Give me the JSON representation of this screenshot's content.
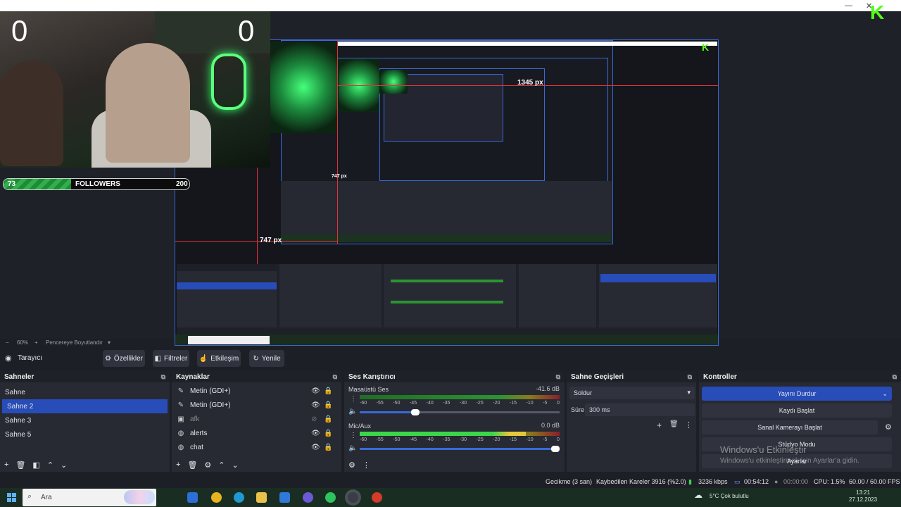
{
  "window": {
    "minimize": "—",
    "close": "✕"
  },
  "overlay": {
    "score_left": "0",
    "score_right": "0",
    "followers": {
      "current": "73",
      "label": "FOLLOWERS",
      "goal": "200",
      "progress": 0.365
    },
    "kick_logo": "K"
  },
  "preview_labels": {
    "width_label": "1345 px",
    "height_label": "747 px",
    "inner_height_label": "747 px"
  },
  "zoom": {
    "minus": "−",
    "value": "60%",
    "plus": "+",
    "fit": "Pencereye Boyutlandır",
    "arrow": "▾"
  },
  "toolbar": {
    "source_label": "Tarayıcı",
    "properties": "Özellikler",
    "filters": "Filtreler",
    "interact": "Etkileşim",
    "refresh": "Yenile"
  },
  "scenes": {
    "title": "Sahneler",
    "items": [
      {
        "label": "Sahne"
      },
      {
        "label": "Sahne 2"
      },
      {
        "label": "Sahne 3"
      },
      {
        "label": "Sahne 5"
      }
    ]
  },
  "sources": {
    "title": "Kaynaklar",
    "items": [
      {
        "label": "Metin (GDI+)",
        "icon": "text-icon"
      },
      {
        "label": "Metin (GDI+)",
        "icon": "text-icon"
      },
      {
        "label": "afk",
        "icon": "image-icon"
      },
      {
        "label": "alerts",
        "icon": "browser-icon"
      },
      {
        "label": "chat",
        "icon": "browser-icon"
      }
    ]
  },
  "mixer": {
    "title": "Ses Karıştırıcı",
    "channels": [
      {
        "name": "Masaüstü Ses",
        "db": "-41.6 dB",
        "level": 0.0,
        "volume": 0.27
      },
      {
        "name": "Mic/Aux",
        "db": "0.0 dB",
        "level": 0.83,
        "volume": 1.0
      }
    ],
    "ticks": [
      "-60",
      "-55",
      "-50",
      "-45",
      "-40",
      "-35",
      "-30",
      "-25",
      "-20",
      "-15",
      "-10",
      "-5",
      "0"
    ]
  },
  "transitions": {
    "title": "Sahne Geçişleri",
    "selected": "Soldur",
    "duration_label": "Süre",
    "duration": "300 ms"
  },
  "controls": {
    "title": "Kontroller",
    "stop_stream": "Yayını Durdur",
    "start_recording": "Kaydı Başlat",
    "start_virtualcam": "Sanal Kamerayı Başlat",
    "studio_mode": "Stüdyo Modu",
    "settings": "Ayarlar",
    "watermark_title": "Windows'u Etkinleştir",
    "watermark_body": "Windows'u etkinleştirmek için Ayarlar'a gidin."
  },
  "status": {
    "delay": "Gecikme (3 san)",
    "dropped": "Kaybedilen Kareler 3916 (%2.0)",
    "bitrate": "3236 kbps",
    "live_time": "00:54:12",
    "rec_time": "00:00:00",
    "cpu": "CPU: 1.5%",
    "fps": "60.00 / 60.00 FPS"
  },
  "taskbar": {
    "search_placeholder": "Ara",
    "weather": "5°C Çok bulutlu",
    "time": "13:21",
    "date": "27.12.2023"
  },
  "colors": {
    "accent": "#284cb8",
    "selection_border": "#3b68d8",
    "kick_green": "#53fc18"
  }
}
